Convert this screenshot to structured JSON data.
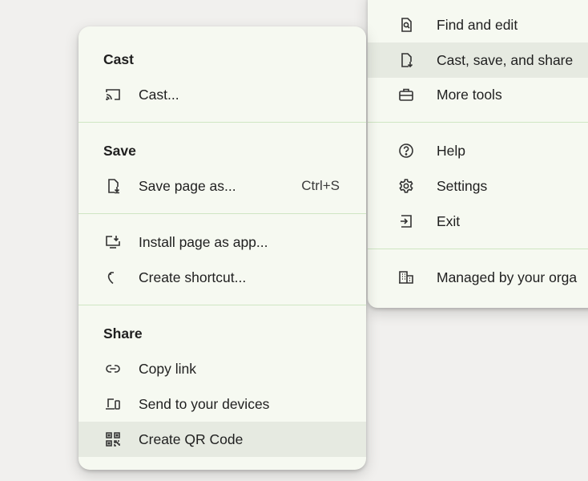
{
  "main_menu": {
    "items": [
      {
        "label": "Find and edit",
        "icon": "find-edit-icon"
      },
      {
        "label": "Cast, save, and share",
        "icon": "cast-save-share-icon"
      },
      {
        "label": "More tools",
        "icon": "toolbox-icon"
      },
      {
        "label": "Help",
        "icon": "help-icon"
      },
      {
        "label": "Settings",
        "icon": "gear-icon"
      },
      {
        "label": "Exit",
        "icon": "exit-icon"
      },
      {
        "label": "Managed by your orga",
        "icon": "building-icon"
      }
    ]
  },
  "submenu": {
    "cast": {
      "heading": "Cast",
      "items": [
        {
          "label": "Cast...",
          "icon": "cast-icon"
        }
      ]
    },
    "save": {
      "heading": "Save",
      "items": [
        {
          "label": "Save page as...",
          "shortcut": "Ctrl+S",
          "icon": "save-page-icon"
        },
        {
          "label": "Install page as app...",
          "icon": "install-app-icon"
        },
        {
          "label": "Create shortcut...",
          "icon": "shortcut-icon"
        }
      ]
    },
    "share": {
      "heading": "Share",
      "items": [
        {
          "label": "Copy link",
          "icon": "link-icon"
        },
        {
          "label": "Send to your devices",
          "icon": "devices-icon"
        },
        {
          "label": "Create QR Code",
          "icon": "qr-code-icon"
        }
      ]
    }
  }
}
